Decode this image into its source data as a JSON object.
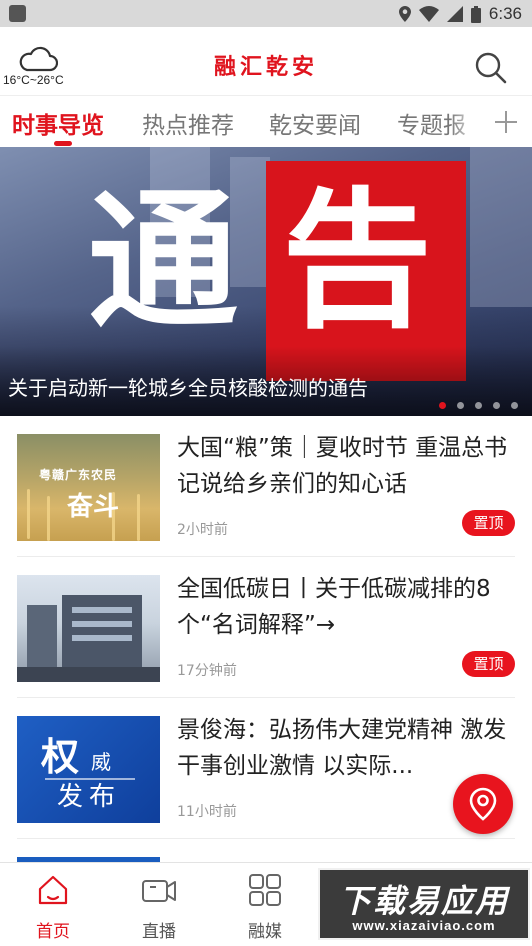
{
  "status_bar": {
    "time": "6:36",
    "icons": [
      "notification-icon",
      "location-icon",
      "wifi-icon",
      "signal-icon",
      "battery-icon"
    ]
  },
  "header": {
    "weather_text": "16°C~26°C",
    "weather_icon": "cloud-icon",
    "logo": "融汇乾安",
    "search_icon": "search-icon"
  },
  "tabs": {
    "items": [
      {
        "label": "时事导览",
        "active": true
      },
      {
        "label": "热点推荐",
        "active": false
      },
      {
        "label": "乾安要闻",
        "active": false
      },
      {
        "label": "专题报",
        "active": false
      }
    ],
    "add_icon": "plus-icon"
  },
  "banner": {
    "big_char_1": "通",
    "big_char_2": "告",
    "caption": "关于启动新一轮城乡全员核酸检测的通告",
    "dots_count": 5,
    "active_dot": 0
  },
  "news": [
    {
      "title": "大国“粮”策｜夏收时节 重温总书记说给乡亲们的知心话",
      "time": "2小时前",
      "pinned": "置顶",
      "thumb_text_1": "粤赣广东农民",
      "thumb_text_2": "奋斗"
    },
    {
      "title": "全国低碳日丨关于低碳减排的8个“名词解释”→",
      "time": "17分钟前",
      "pinned": "置顶"
    },
    {
      "title": "景俊海：弘扬伟大建党精神 激发干事创业激情 以实际...",
      "time": "11小时前",
      "thumb_text_1": "权",
      "thumb_text_2": "威",
      "thumb_text_3": "发布"
    }
  ],
  "fab_icon": "location-pin-icon",
  "bottom_nav": [
    {
      "label": "首页",
      "icon": "home-icon",
      "active": true
    },
    {
      "label": "直播",
      "icon": "video-camera-icon",
      "active": false
    },
    {
      "label": "融媒",
      "icon": "grid-icon",
      "active": false
    }
  ],
  "watermark": {
    "line1": "下载易应用",
    "line2": "www.xiazaiviao.com"
  },
  "colors": {
    "accent": "#e0141e",
    "banner_red": "#d8141c"
  }
}
